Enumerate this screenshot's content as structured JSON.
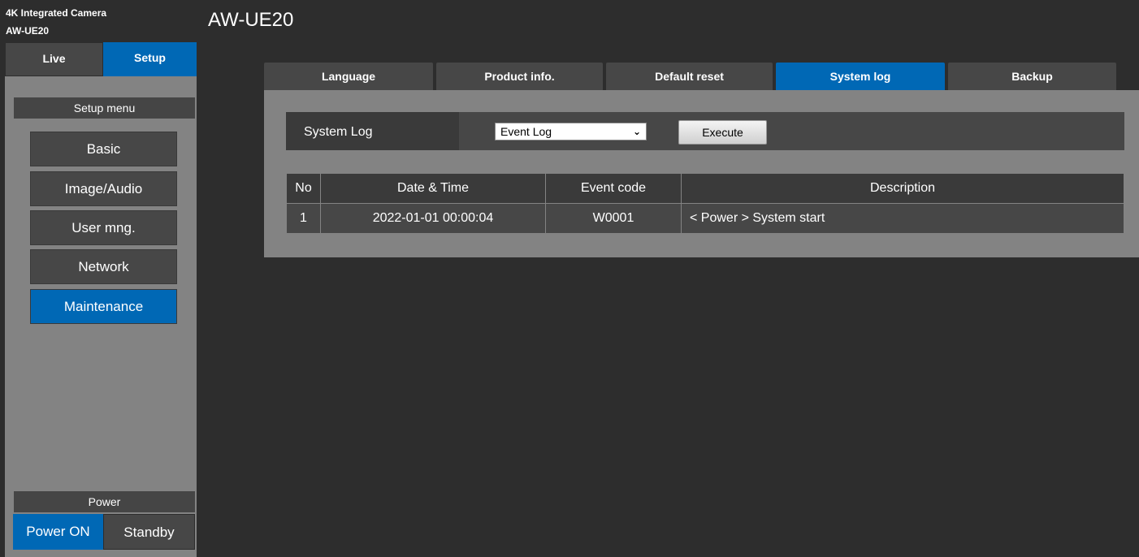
{
  "device": {
    "model_line1": "4K Integrated Camera",
    "model_line2": "AW-UE20"
  },
  "mode_tabs": {
    "live": "Live",
    "setup": "Setup"
  },
  "setup_menu": {
    "title": "Setup menu",
    "items": [
      {
        "label": "Basic",
        "active": false
      },
      {
        "label": "Image/Audio",
        "active": false
      },
      {
        "label": "User mng.",
        "active": false
      },
      {
        "label": "Network",
        "active": false
      },
      {
        "label": "Maintenance",
        "active": true
      }
    ]
  },
  "power": {
    "title": "Power",
    "on_label": "Power ON",
    "standby_label": "Standby"
  },
  "page_title": "AW-UE20",
  "tabs": [
    {
      "label": "Language",
      "active": false
    },
    {
      "label": "Product info.",
      "active": false
    },
    {
      "label": "Default reset",
      "active": false
    },
    {
      "label": "System log",
      "active": true
    },
    {
      "label": "Backup",
      "active": false
    }
  ],
  "system_log": {
    "label": "System Log",
    "select_value": "Event Log",
    "execute_label": "Execute"
  },
  "table": {
    "headers": [
      "No",
      "Date & Time",
      "Event code",
      "Description"
    ],
    "rows": [
      [
        "1",
        "2022-01-01 00:00:04",
        "W0001",
        "< Power > System start"
      ]
    ]
  },
  "colors": {
    "accent": "#0068b5",
    "panel": "#838383",
    "background": "#2d2d2d",
    "button": "#474747"
  }
}
